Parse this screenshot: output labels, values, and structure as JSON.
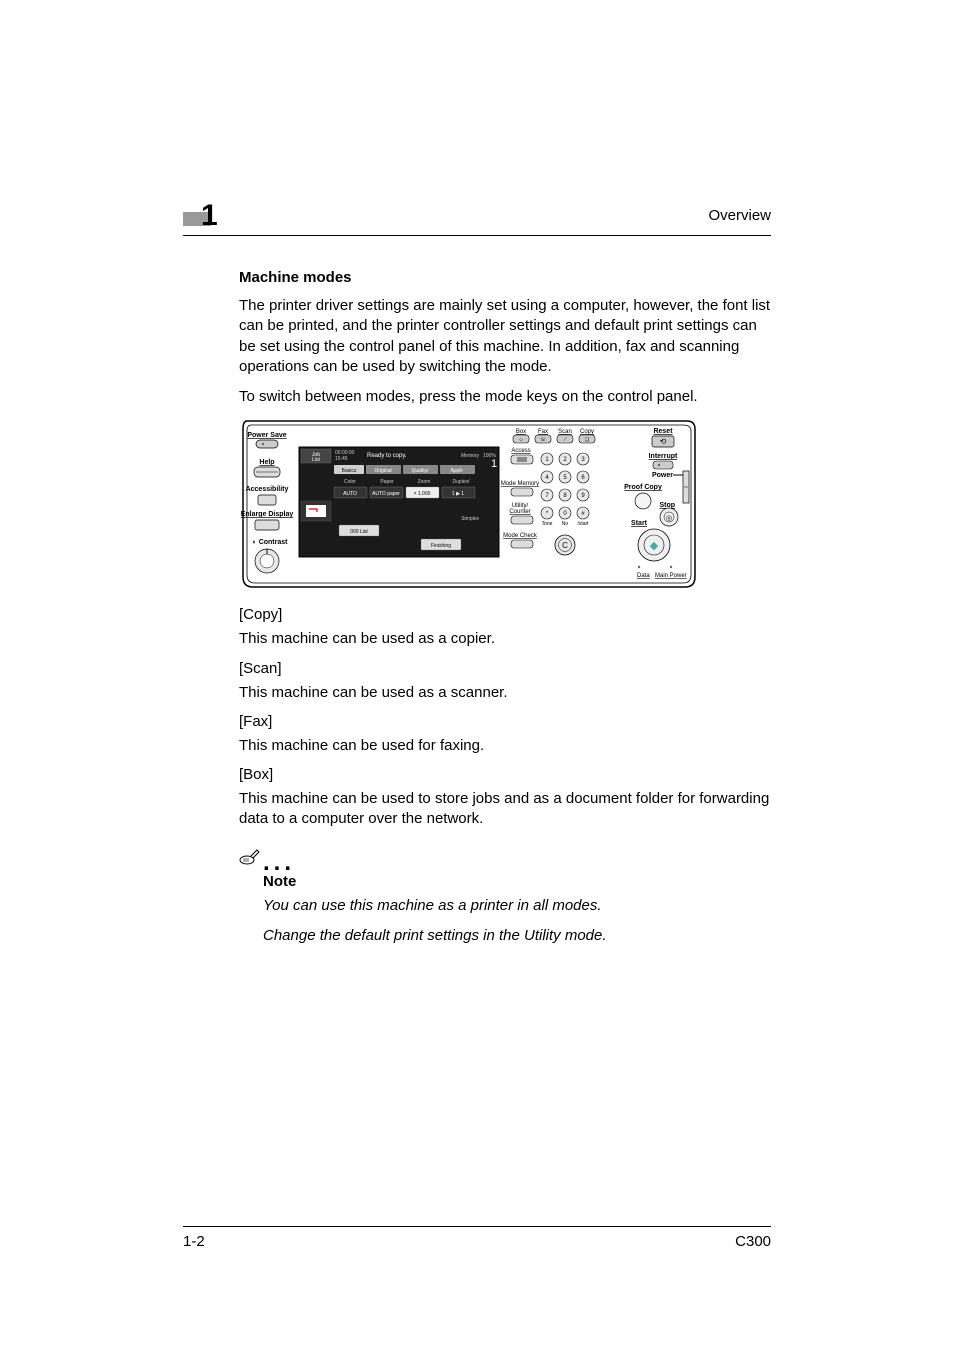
{
  "header": {
    "chapter_number": "1",
    "title": "Overview"
  },
  "section": {
    "heading": "Machine modes",
    "para1": "The printer driver settings are mainly set using a computer, however, the font list can be printed, and the printer controller settings and default print settings can be set using the control panel of this machine. In addition, fax and scanning operations can be used by switching the mode.",
    "para2": "To switch between modes, press the mode keys on the control panel."
  },
  "panel": {
    "left": {
      "power_save": "Power Save",
      "help": "Help",
      "accessibility": "Accessibility",
      "enlarge_display": "Enlarge Display",
      "contrast": "Contrast"
    },
    "screen": {
      "status_main": "Ready to copy.",
      "memory_label": "Memory",
      "memory_value": "100%",
      "count": "1",
      "tabs": [
        "Basics",
        "Original",
        "Quality/",
        "Appli-"
      ],
      "row_labels": [
        "Color",
        "Paper",
        "Zoom",
        "Duplex/"
      ],
      "row_buttons": [
        "AUTO",
        "AUTO paper",
        "× 1.000",
        "1 ▶ 1"
      ],
      "jobs_queue": "000 List",
      "simplex": "Simplex",
      "finishing": "Finishing"
    },
    "mode_keys": {
      "box": "Box",
      "fax": "Fax",
      "scan": "Scan",
      "copy": "Copy"
    },
    "labels": {
      "access": "Access",
      "mode_memory": "Mode Memory",
      "utility_counter": "Utility/\nCounter",
      "mode_check": "Mode Check",
      "tone": "Tone",
      "no": "No",
      "start": "/start",
      "reset": "Reset",
      "interrupt": "Interrupt",
      "power": "Power",
      "proof_copy": "Proof Copy",
      "stop": "Stop",
      "start_btn": "Start",
      "data": "Data",
      "main_power": "Main Power"
    },
    "keypad": [
      "1",
      "2",
      "3",
      "4",
      "5",
      "6",
      "7",
      "8",
      "9",
      "*",
      "0",
      "#"
    ],
    "clear_key": "C"
  },
  "modes": [
    {
      "label": "[Copy]",
      "desc": "This machine can be used as a copier."
    },
    {
      "label": "[Scan]",
      "desc": "This machine can be used as a scanner."
    },
    {
      "label": "[Fax]",
      "desc": "This machine can be used for faxing."
    },
    {
      "label": "[Box]",
      "desc": "This machine can be used to store jobs and as a document folder for forwarding data to a computer over the network."
    }
  ],
  "note": {
    "heading": "Note",
    "line1": "You can use this machine as a printer in all modes.",
    "line2": "Change the default print settings in the Utility mode."
  },
  "footer": {
    "page_num": "1-2",
    "model": "C300"
  }
}
